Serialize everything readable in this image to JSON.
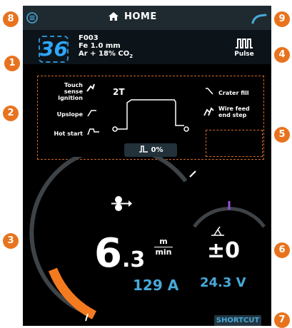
{
  "header": {
    "title": "HOME",
    "left_icon": "menu-icon",
    "right_icon": "torch-icon"
  },
  "program": {
    "memory": "36",
    "code": "F003",
    "wire": "Fe 1.0 mm",
    "gas": "Ar  + 18% CO",
    "gas_sub": "2"
  },
  "process": {
    "label": "Pulse",
    "icon": "pulse-icon"
  },
  "welding_params": {
    "touch_sense": "Touch sense",
    "ignition": "Ignition",
    "upslope": "Upslope",
    "hot_start": "Hot start",
    "mode": "2T",
    "crater_fill": "Crater fill",
    "wire_feed": "Wire feed",
    "end_step": "end step",
    "pulse_percent": "0%"
  },
  "main": {
    "wire_speed_int": "6",
    "wire_speed_dec": ".3",
    "wire_speed_unit_top": "m",
    "wire_speed_unit_bottom": "min",
    "current": "129 A",
    "correction": "±0",
    "voltage": "24.3 V",
    "wire_speed_fill_fraction": 0.18
  },
  "shortcut": {
    "label": "SHORTCUT"
  },
  "callouts": [
    "1",
    "2",
    "3",
    "4",
    "5",
    "6",
    "7",
    "8",
    "9"
  ],
  "colors": {
    "accent": "#e8731e",
    "blue": "#48a9d8",
    "badge_blue": "#2fa7ff",
    "bg": "#000000",
    "panel_border": "#d2692a"
  }
}
